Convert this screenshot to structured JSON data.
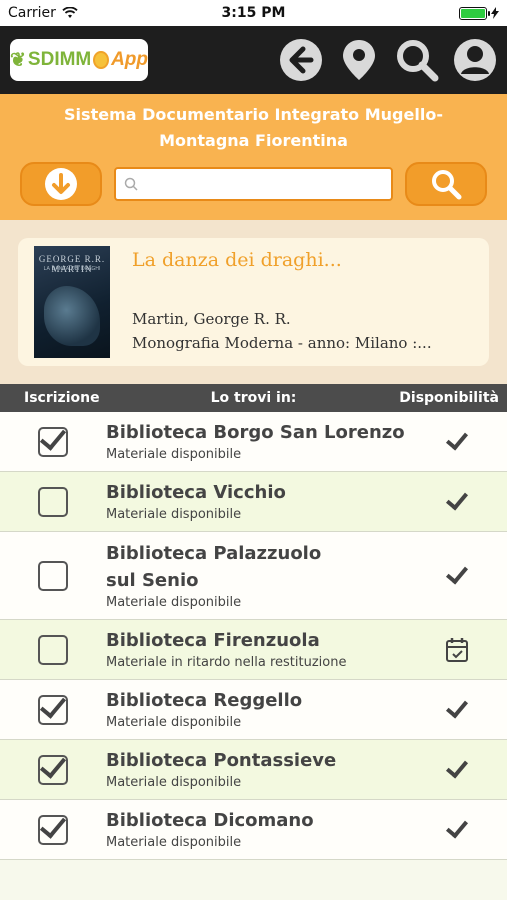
{
  "status_bar": {
    "carrier": "Carrier",
    "time": "3:15 PM"
  },
  "topbar": {
    "logo_text": "SDIMM",
    "logo_app": "App",
    "icons": [
      "back-arrow-icon",
      "location-pin-icon",
      "search-icon",
      "user-icon"
    ]
  },
  "header": {
    "title_line1": "Sistema Documentario Integrato Mugello-",
    "title_line2": "Montagna Fiorentina",
    "search_placeholder": "",
    "search_value": ""
  },
  "book": {
    "cover_author": "GEORGE R.R. MARTIN",
    "cover_title": "LA DANZA DEI DRAGHI",
    "title": "La danza dei draghi...",
    "author": "Martin, George R. R.",
    "type_line": "Monografia Moderna - anno: Milano :..."
  },
  "columns": {
    "col1": "Iscrizione",
    "col2": "Lo trovi in:",
    "col3": "Disponibilità"
  },
  "libraries": [
    {
      "name": "Biblioteca  Borgo San Lorenzo",
      "name_line2": "",
      "status": "Materiale disponibile",
      "subscribed": true,
      "availability": "check-icon"
    },
    {
      "name": "Biblioteca  Vicchio",
      "name_line2": "",
      "status": "Materiale disponibile",
      "subscribed": false,
      "availability": "check-icon"
    },
    {
      "name": "Biblioteca Palazzuolo",
      "name_line2": "sul Senio",
      "status": "Materiale disponibile",
      "subscribed": false,
      "availability": "check-icon"
    },
    {
      "name": "Biblioteca Firenzuola",
      "name_line2": "",
      "status": "Materiale in ritardo nella restituzione",
      "subscribed": false,
      "availability": "calendar-icon"
    },
    {
      "name": "Biblioteca Reggello",
      "name_line2": "",
      "status": "Materiale disponibile",
      "subscribed": true,
      "availability": "check-icon"
    },
    {
      "name": "Biblioteca Pontassieve",
      "name_line2": "",
      "status": "Materiale disponibile",
      "subscribed": true,
      "availability": "check-icon"
    },
    {
      "name": "Biblioteca Dicomano",
      "name_line2": "",
      "status": "Materiale disponibile",
      "subscribed": true,
      "availability": "check-icon"
    }
  ],
  "colors": {
    "accent_orange": "#f9b350",
    "button_orange": "#f29d2a",
    "title_orange": "#f0a02a",
    "dark_bar": "#1e1e1e",
    "row_green": "#f3f9e0"
  }
}
